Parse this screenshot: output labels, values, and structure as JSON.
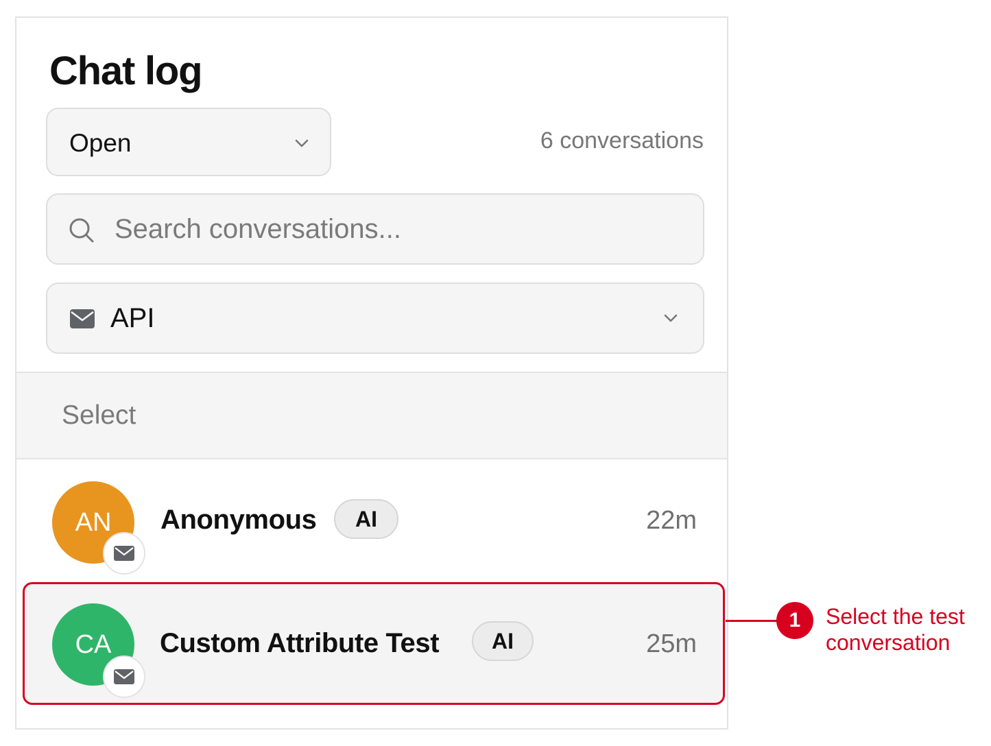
{
  "header": {
    "title": "Chat log"
  },
  "filters": {
    "status_value": "Open",
    "count_text": "6 conversations",
    "search_placeholder": "Search conversations...",
    "channel_value": "API"
  },
  "list": {
    "select_label": "Select",
    "conversations": [
      {
        "initials": "AN",
        "name": "Anonymous",
        "tag": "AI",
        "time": "22m",
        "avatar_color": "#e8951f",
        "channel_icon": "mail-icon"
      },
      {
        "initials": "CA",
        "name": "Custom Attribute Test",
        "tag": "AI",
        "time": "25m",
        "avatar_color": "#2fb56a",
        "channel_icon": "mail-icon"
      }
    ]
  },
  "annotation": {
    "number": "1",
    "text": "Select the test conversation",
    "color": "#d8001f"
  },
  "colors": {
    "accent": "#d8001f",
    "panel_bg": "#ffffff",
    "field_bg": "#f5f5f5"
  }
}
